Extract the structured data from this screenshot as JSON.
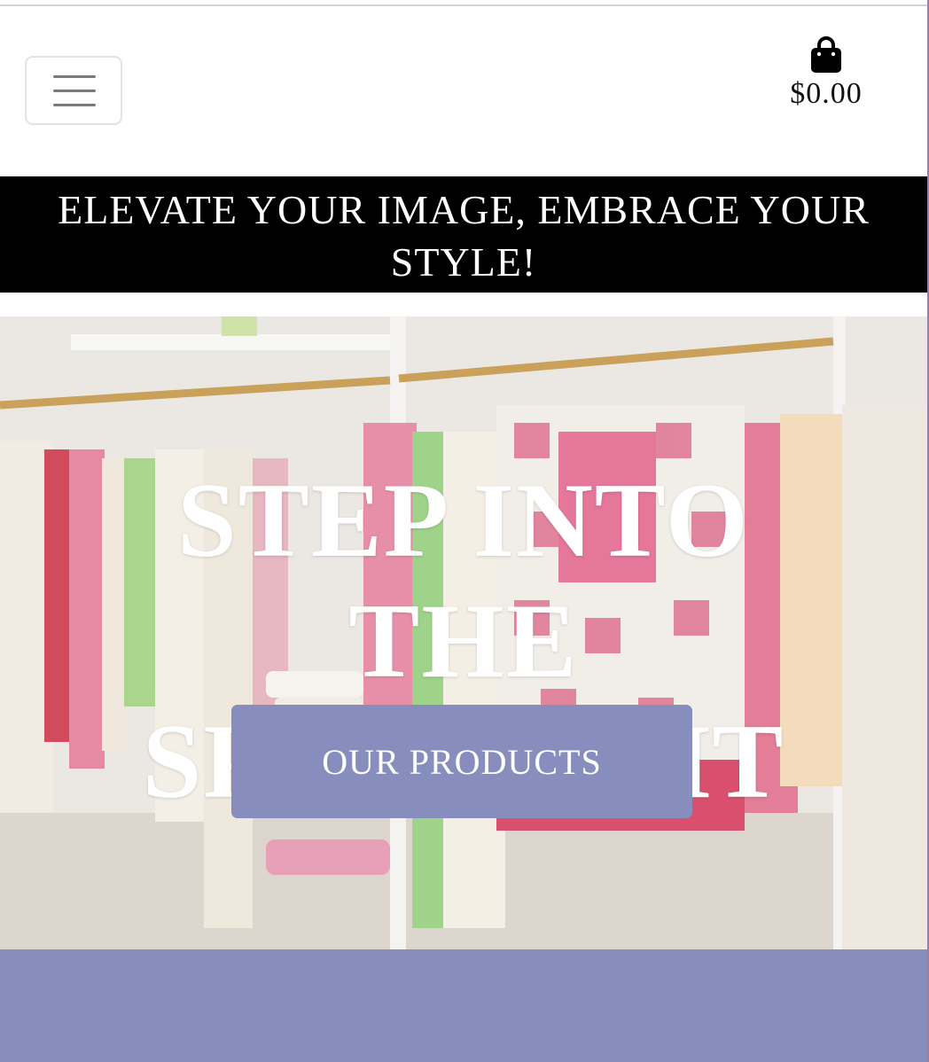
{
  "header": {
    "menu_toggle_label": "Toggle navigation",
    "cart_icon": "shopping-bag-icon",
    "cart_total": "$0.00"
  },
  "banner": {
    "text": "ELEVATE YOUR IMAGE, EMBRACE YOUR STYLE!"
  },
  "hero": {
    "title": "STEP INTO THE SPOTLIGHT",
    "cta_label": "OUR PRODUCTS",
    "image_description_icon": "clothing-rack-photo"
  },
  "colors": {
    "accent": "#878ebe",
    "banner_bg": "#000000",
    "text_light": "#ffffff"
  }
}
